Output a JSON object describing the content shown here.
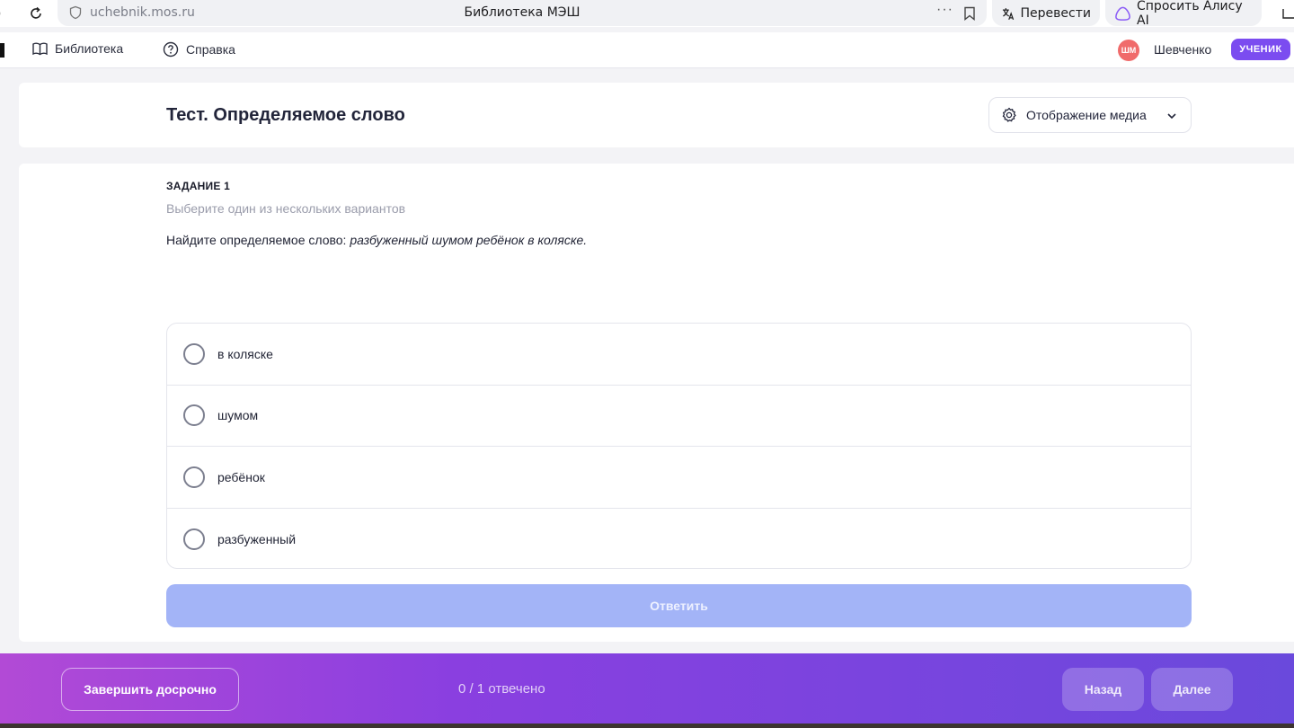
{
  "browser": {
    "url": "uchebnik.mos.ru",
    "page_title": "Библиотека МЭШ",
    "translate_label": "Перевести",
    "alice_label": "Спросить Алису AI"
  },
  "nav": {
    "library": "Библиотека",
    "help": "Справка",
    "avatar_initials": "ШМ",
    "user_name": "Шевченко",
    "role_badge": "УЧЕНИК"
  },
  "test": {
    "title": "Тест. Определяемое слово",
    "media_button": "Отображение медиа"
  },
  "task": {
    "label": "ЗАДАНИЕ 1",
    "hint": "Выберите один из нескольких вариантов",
    "prompt": "Найдите определяемое слово: ",
    "prompt_phrase": "разбуженный шумом ребёнок в коляске.",
    "options": [
      {
        "label": "в коляске"
      },
      {
        "label": "шумом"
      },
      {
        "label": "ребёнок"
      },
      {
        "label": "разбуженный"
      }
    ],
    "answer_button": "Ответить"
  },
  "footer": {
    "finish_button": "Завершить досрочно",
    "progress": "0 / 1 отвечено",
    "back_button": "Назад",
    "next_button": "Далее"
  },
  "colors": {
    "accent": "#7b4cf0",
    "answer_disabled": "#a3b4f7",
    "avatar": "#f06b6b"
  }
}
